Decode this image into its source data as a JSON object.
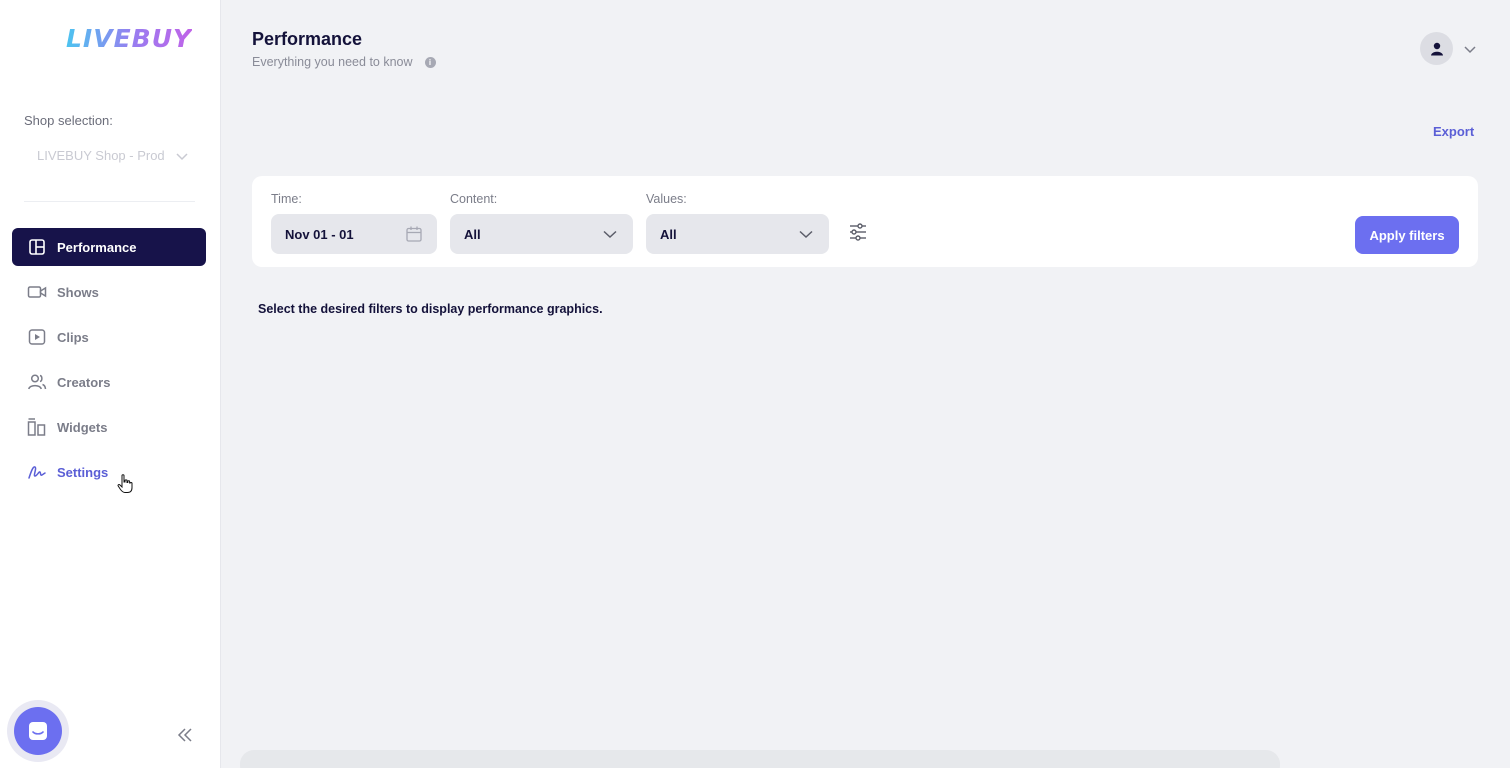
{
  "sidebar": {
    "logo": "LIVEBUY",
    "shop_label": "Shop selection:",
    "shop_value": "LIVEBUY Shop - Prod",
    "items": [
      {
        "label": "Performance",
        "icon": "layout-icon",
        "active": true
      },
      {
        "label": "Shows",
        "icon": "video-icon"
      },
      {
        "label": "Clips",
        "icon": "play-icon"
      },
      {
        "label": "Creators",
        "icon": "users-icon"
      },
      {
        "label": "Widgets",
        "icon": "widgets-icon"
      },
      {
        "label": "Settings",
        "icon": "signature-icon",
        "hover": true
      }
    ]
  },
  "header": {
    "title": "Performance",
    "subtitle": "Everything you need to know",
    "info_icon": "i"
  },
  "toolbar": {
    "export_label": "Export"
  },
  "filters": {
    "time_label": "Time:",
    "time_value": "Nov 01 - 01",
    "content_label": "Content:",
    "content_value": "All",
    "values_label": "Values:",
    "values_value": "All",
    "apply_label": "Apply filters"
  },
  "main": {
    "hint": "Select the desired filters to display performance graphics."
  },
  "colors": {
    "accent": "#6c6ff0",
    "nav_active": "#17134a",
    "background": "#f1f2f5"
  }
}
